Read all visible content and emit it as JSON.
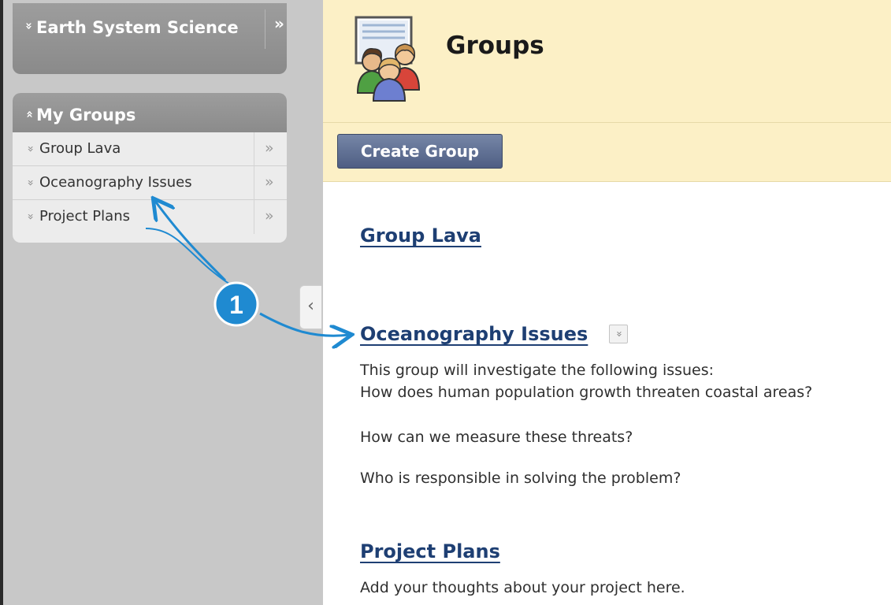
{
  "sidebar": {
    "course_title": "Earth System Science",
    "my_groups_label": "My Groups",
    "groups": [
      {
        "label": "Group Lava"
      },
      {
        "label": "Oceanography Issues"
      },
      {
        "label": "Project Plans"
      }
    ]
  },
  "header": {
    "title": "Groups",
    "create_button": "Create Group"
  },
  "main": {
    "groups": [
      {
        "name": "Group Lava"
      },
      {
        "name": "Oceanography Issues",
        "description": [
          "This group will investigate the following issues:",
          "How does human population growth threaten coastal areas?",
          "How can we measure these threats?",
          "Who is responsible in solving the problem?"
        ]
      },
      {
        "name": "Project Plans",
        "description": [
          "Add your thoughts about your project here."
        ]
      }
    ]
  },
  "annotation": {
    "callout_number": "1"
  },
  "colors": {
    "sidebar_bg": "#c8c8c8",
    "header_bg": "#fcf0c6",
    "link": "#1e3f73",
    "button": "#5a6a8e",
    "callout": "#1f8ad1"
  },
  "icons": {
    "chevron_down": "»",
    "chevron_up": "»",
    "open_arrow": "»",
    "collapse_arrow": "‹"
  }
}
